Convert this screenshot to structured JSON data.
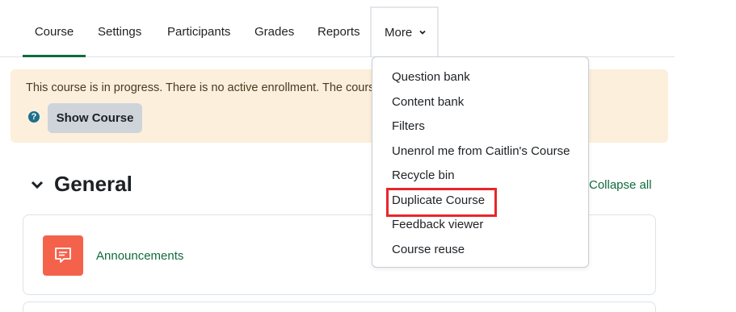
{
  "nav": {
    "tabs": [
      {
        "label": "Course",
        "active": true
      },
      {
        "label": "Settings"
      },
      {
        "label": "Participants"
      },
      {
        "label": "Grades"
      },
      {
        "label": "Reports"
      }
    ],
    "more_label": "More",
    "more_icon": "chevron-down-icon"
  },
  "alert": {
    "text": "This course is in progress. There is no active enrollment. The course",
    "help_icon": "question-circle-icon",
    "button_label": "Show Course"
  },
  "section": {
    "title": "General",
    "collapse_label": "Collapse all"
  },
  "activities": [
    {
      "name": "Announcements",
      "icon": "forum-icon",
      "icon_color": "#f5624c"
    }
  ],
  "more_menu": {
    "items": [
      "Question bank",
      "Content bank",
      "Filters",
      "Unenrol me from Caitlin's Course",
      "Recycle bin",
      "Duplicate Course",
      "Feedback viewer",
      "Course reuse"
    ],
    "highlighted_item": "Duplicate Course",
    "highlight_color": "#e8262a"
  },
  "colors": {
    "accent": "#0f6b3c",
    "alert_bg": "#fcefdc"
  }
}
